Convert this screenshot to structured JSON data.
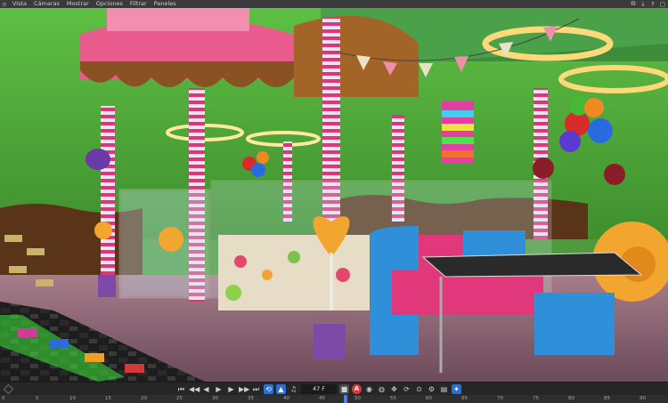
{
  "menu": {
    "items": [
      "Vista",
      "Cámaras",
      "Mostrar",
      "Opciones",
      "Filtrar",
      "Paneles"
    ]
  },
  "window_controls": [
    "⧉",
    "↓",
    "↑",
    "▢"
  ],
  "timeline": {
    "current_frame": "47 F"
  },
  "ruler": {
    "ticks": [
      "0",
      "5",
      "10",
      "15",
      "20",
      "25",
      "30",
      "35",
      "40",
      "45",
      "50",
      "55",
      "60",
      "65",
      "70",
      "75",
      "80",
      "85",
      "90"
    ]
  },
  "colors": {
    "accent_blue": "#2d6fd0",
    "record_red": "#d83a3a"
  }
}
